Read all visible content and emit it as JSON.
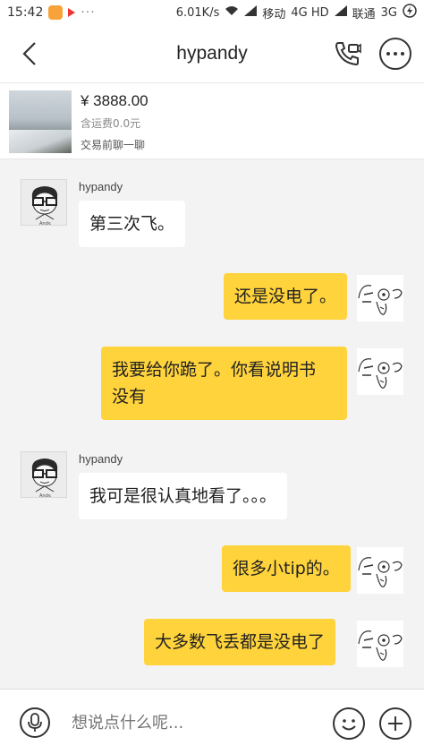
{
  "status_bar": {
    "time": "15:42",
    "net_speed": "6.01K/s",
    "carrier1": "移动",
    "network1": "4G HD",
    "carrier2": "联通",
    "network2": "3G"
  },
  "header": {
    "title": "hypandy"
  },
  "product": {
    "price": "¥ 3888.00",
    "shipping": "含运费0.0元",
    "chat_prompt": "交易前聊一聊"
  },
  "messages": [
    {
      "side": "in",
      "sender": "hypandy",
      "text": "第三次飞。"
    },
    {
      "side": "out",
      "text": "还是没电了。"
    },
    {
      "side": "out",
      "lines": [
        "我要给你跪了。你看说明书",
        "没有"
      ]
    },
    {
      "side": "in",
      "sender": "hypandy",
      "text": "我可是很认真地看了。。。"
    },
    {
      "side": "out",
      "text": "很多小tip的。"
    },
    {
      "side": "out",
      "text": "大多数飞丢都是没电了"
    }
  ],
  "input": {
    "placeholder": "想说点什么呢..."
  },
  "colors": {
    "out_bubble": "#ffd33b",
    "in_bubble": "#ffffff",
    "background": "#f3f3f3"
  }
}
